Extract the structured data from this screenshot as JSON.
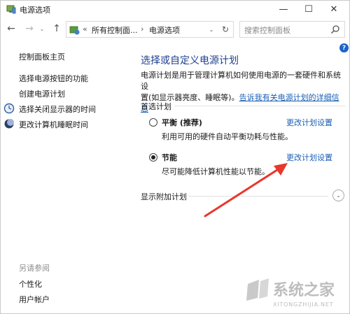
{
  "window": {
    "title": "电源选项",
    "min_glyph": "—",
    "max_glyph": "☐",
    "close_glyph": "✕"
  },
  "nav": {
    "back_glyph": "←",
    "forward_glyph": "→",
    "recent_glyph": "⌄",
    "up_glyph": "↑"
  },
  "address": {
    "prefix": "«",
    "crumb1": "所有控制面...",
    "sep": "›",
    "crumb2": "电源选项",
    "dropdown_glyph": "⌄",
    "refresh_glyph": "↻"
  },
  "search": {
    "placeholder": "搜索控制面板"
  },
  "sidebar": {
    "home": "控制面板主页",
    "items": [
      {
        "label": "选择电源按钮的功能",
        "icon": "none"
      },
      {
        "label": "创建电源计划",
        "icon": "none"
      },
      {
        "label": "选择关闭显示器的时间",
        "icon": "clock-monitor-icon"
      },
      {
        "label": "更改计算机睡眠时间",
        "icon": "moon-icon"
      }
    ],
    "see_also_title": "另请参阅",
    "see_also": [
      "个性化",
      "用户帐户"
    ]
  },
  "main": {
    "help_glyph": "?",
    "title": "选择或自定义电源计划",
    "desc_line1": "电源计划是用于管理计算机如何使用电源的一套硬件和系统设",
    "desc_line2_prefix": "置(如显示器亮度、睡眠等)。",
    "desc_link": "告诉我有关电源计划的详细信息",
    "preferred_label": "首选计划",
    "plans": [
      {
        "name": "平衡 (推荐)",
        "desc": "利用可用的硬件自动平衡功耗与性能。",
        "link": "更改计划设置",
        "selected": false
      },
      {
        "name": "节能",
        "desc": "尽可能降低计算机性能以节能。",
        "link": "更改计划设置",
        "selected": true
      }
    ],
    "additional_label": "显示附加计划",
    "expand_glyph": "⌄"
  },
  "annotation": {
    "arrow_color": "#e8372c"
  },
  "watermark": {
    "text_cn": "系统之家",
    "text_en": "XITONGZHIJIA.NET"
  }
}
